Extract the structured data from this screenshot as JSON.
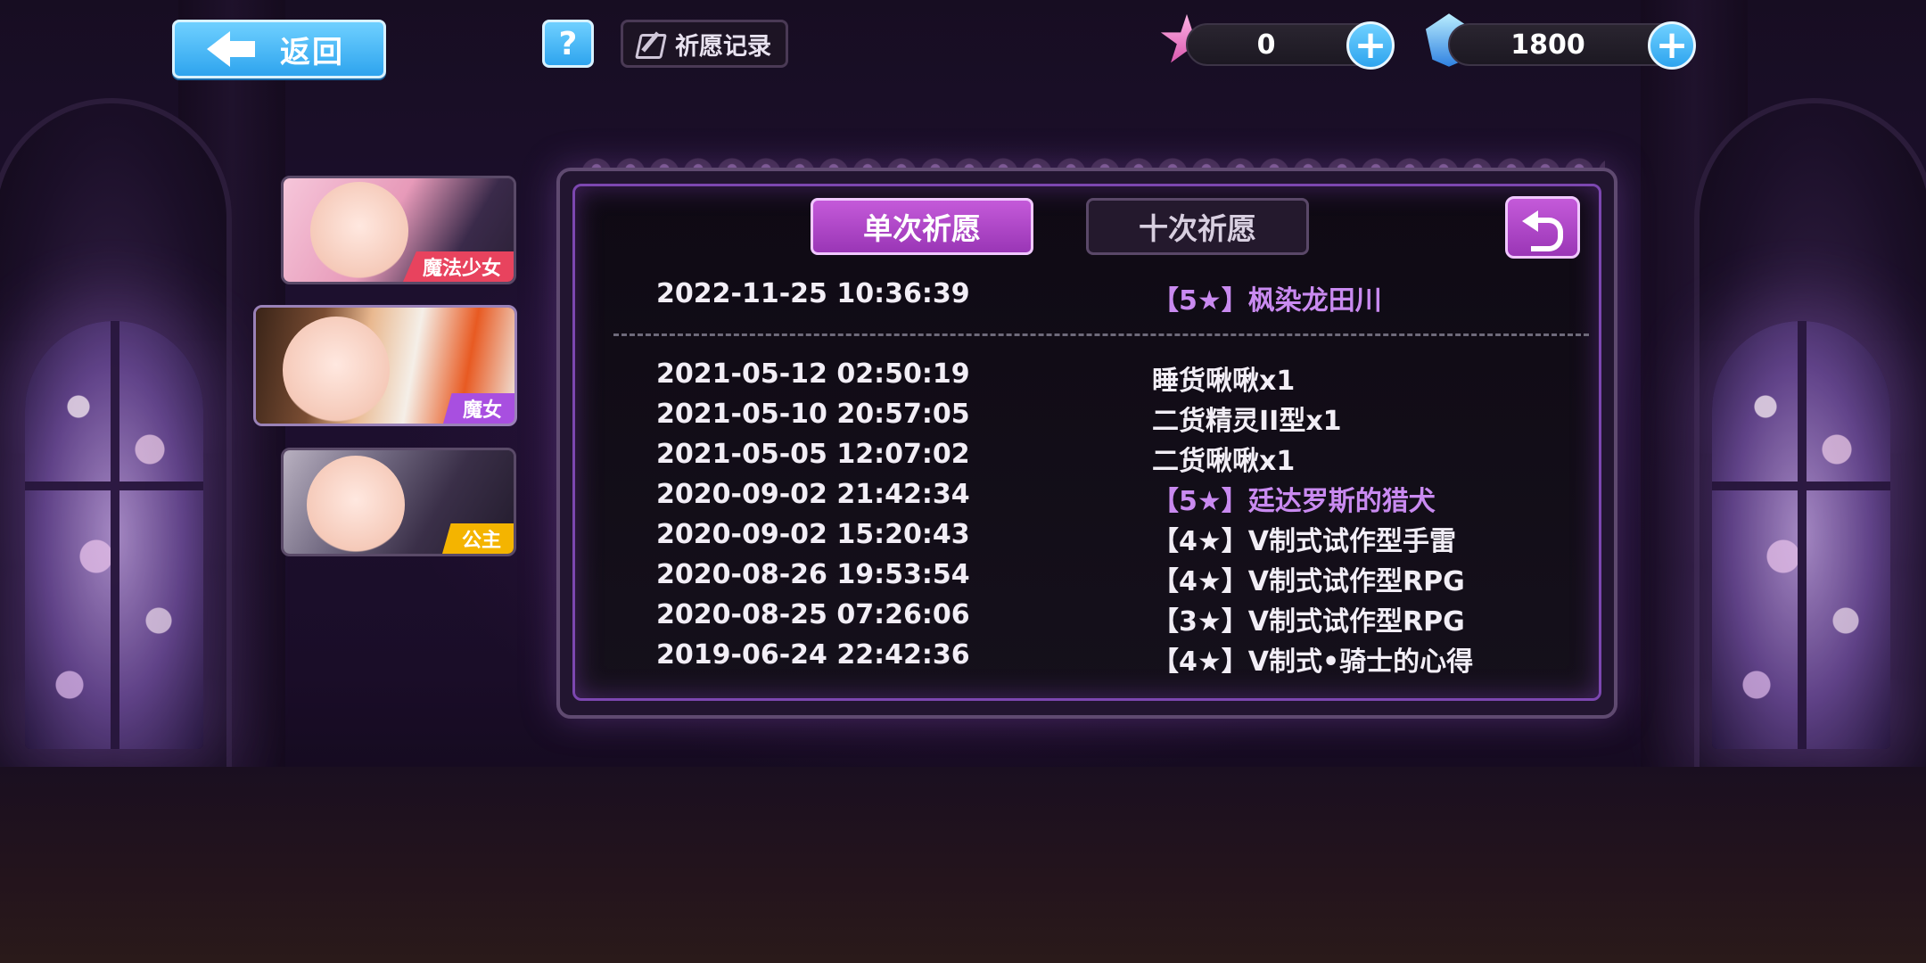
{
  "topbar": {
    "back_label": "返回",
    "help_label": "?",
    "record_label": "祈愿记录",
    "star_currency": {
      "icon": "pink-star-icon",
      "value": "0"
    },
    "gem_currency": {
      "icon": "blue-crystal-icon",
      "value": "1800"
    },
    "plus_symbol": "+"
  },
  "characters": [
    {
      "label": "魔法少女",
      "label_color": "#e8435e",
      "active": false
    },
    {
      "label": "魔女",
      "label_color": "#a84fe0",
      "active": true
    },
    {
      "label": "公主",
      "label_color": "#f4b400",
      "active": false
    }
  ],
  "panel": {
    "tabs": [
      {
        "label": "单次祈愿",
        "active": true
      },
      {
        "label": "十次祈愿",
        "active": false
      }
    ],
    "undo_icon": "undo-arrow-icon",
    "featured": {
      "time": "2022-11-25 10:36:39",
      "item": "【5★】枫染龙田川",
      "highlight": true
    },
    "records": [
      {
        "time": "2021-05-12 02:50:19",
        "item": "睡货啾啾x1",
        "highlight": false
      },
      {
        "time": "2021-05-10 20:57:05",
        "item": "二货精灵II型x1",
        "highlight": false
      },
      {
        "time": "2021-05-05 12:07:02",
        "item": "二货啾啾x1",
        "highlight": false
      },
      {
        "time": "2020-09-02 21:42:34",
        "item": "【5★】廷达罗斯的猎犬",
        "highlight": true
      },
      {
        "time": "2020-09-02 15:20:43",
        "item": "【4★】V制式试作型手雷",
        "highlight": false
      },
      {
        "time": "2020-08-26 19:53:54",
        "item": "【4★】V制式试作型RPG",
        "highlight": false
      },
      {
        "time": "2020-08-25 07:26:06",
        "item": "【3★】V制式试作型RPG",
        "highlight": false
      },
      {
        "time": "2019-06-24 22:42:36",
        "item": "【4★】V制式•骑士的心得",
        "highlight": false
      }
    ]
  },
  "colors": {
    "accent_blue": "#2ea4ee",
    "accent_purple": "#9a36b6",
    "highlight_text": "#c98af0"
  }
}
